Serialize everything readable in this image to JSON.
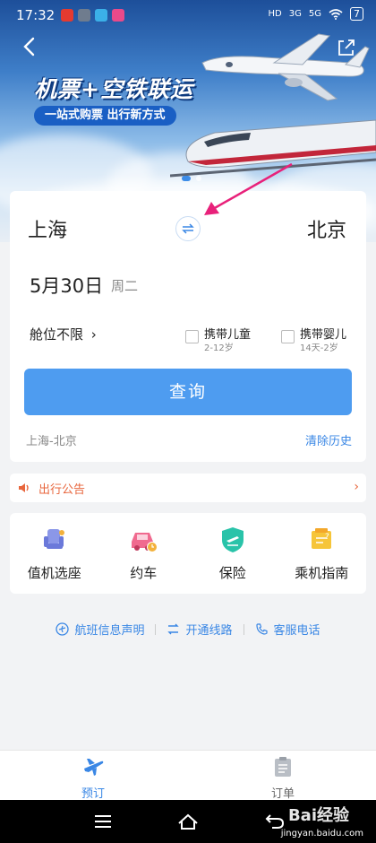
{
  "status_bar": {
    "time": "17:32",
    "signal_a": "HD",
    "network_a": "3G",
    "network_b": "5G",
    "battery": "7"
  },
  "banner": {
    "title": "机票+空铁联运",
    "subtitle": "一站式购票 出行新方式"
  },
  "search": {
    "from_city": "上海",
    "to_city": "北京",
    "date": "5月30日",
    "weekday": "周二",
    "cabin": "舱位不限",
    "child_option": {
      "label": "携带儿童",
      "sub": "2-12岁"
    },
    "infant_option": {
      "label": "携带婴儿",
      "sub": "14天-2岁"
    },
    "search_button": "查询",
    "history_item": "上海-北京",
    "clear_history": "清除历史"
  },
  "notice": {
    "label": "出行公告"
  },
  "services": [
    {
      "label": "值机选座",
      "icon": "seat-icon"
    },
    {
      "label": "约车",
      "icon": "car-icon"
    },
    {
      "label": "保险",
      "icon": "insurance-shield-icon"
    },
    {
      "label": "乘机指南",
      "icon": "guide-icon"
    }
  ],
  "links": [
    {
      "label": "航班信息声明",
      "icon": "plane-circle-icon"
    },
    {
      "label": "开通线路",
      "icon": "route-icon"
    },
    {
      "label": "客服电话",
      "icon": "phone-icon"
    }
  ],
  "tabbar": {
    "book": "预订",
    "orders": "订单"
  },
  "watermark": {
    "main": "Bai经验",
    "url": "jingyan.baidu.com"
  },
  "colors": {
    "accent": "#4e9cf0",
    "link": "#3a87e5",
    "notice": "#e8663d",
    "annotation": "#e8217a"
  }
}
